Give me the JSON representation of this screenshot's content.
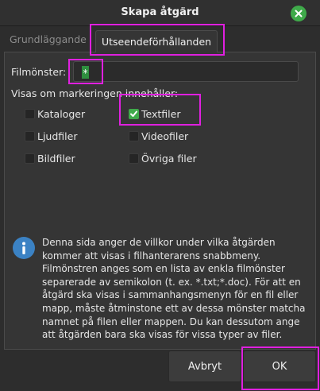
{
  "window": {
    "title": "Skapa åtgärd",
    "close_icon": "close-icon",
    "accent": "#3faa4a"
  },
  "tabs": [
    {
      "label": "Grundläggande",
      "active": false
    },
    {
      "label": "Utseendeförhållanden",
      "active": true
    }
  ],
  "pattern": {
    "label": "Filmönster:",
    "value": "*"
  },
  "selection": {
    "label": "Visas om markeringen innehåller:",
    "options": [
      {
        "label": "Kataloger",
        "checked": false
      },
      {
        "label": "Textfiler",
        "checked": true
      },
      {
        "label": "Ljudfiler",
        "checked": false
      },
      {
        "label": "Videofiler",
        "checked": false
      },
      {
        "label": "Bildfiler",
        "checked": false
      },
      {
        "label": "Övriga filer",
        "checked": false
      }
    ]
  },
  "info": {
    "icon": "info-icon",
    "text": "Denna sida anger de villkor under vilka åtgärden\nkommer att visas i filhanterarens snabbmeny.\nFilmönstren anges som en lista av enkla filmönster\nseparerade av semikolon (t. ex. *.txt;*.doc). För att en\nåtgärd ska visas i sammanhangsmenyn för en fil eller\nmapp, måste åtminstone ett av dessa mönster matcha\nnamnet på filen eller mappen. Du kan dessutom ange\natt åtgärden bara ska visas för vissa typer av filer."
  },
  "buttons": {
    "cancel": "Avbryt",
    "ok": "OK"
  },
  "highlight_color": "#e020e0"
}
